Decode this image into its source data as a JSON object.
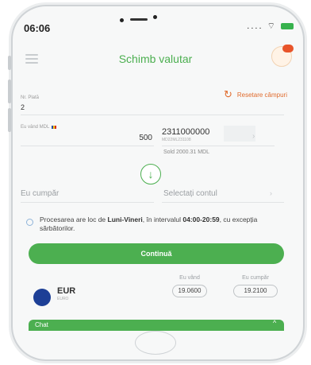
{
  "status": {
    "time": "06:06",
    "signal": "....",
    "wifi": "⌔"
  },
  "header": {
    "title": "Schimb valutar",
    "menu_icon": "hamburger-icon",
    "profile_icon": "avatar-icon"
  },
  "reset": {
    "label": "Resetare câmpuri",
    "icon": "refresh-icon"
  },
  "form": {
    "nr_label": "Nr. Plată",
    "nr_value": "2",
    "sell_label": "Eu vând MDL",
    "sell_amount": "500",
    "account_number": "2311000000",
    "account_masked": "MD22ML231108",
    "balance": "Sold 2000.31 MDL",
    "buy_placeholder": "Eu cumpăr",
    "currency_placeholder": "Selectați contul"
  },
  "info": {
    "part1": "Procesarea are loc de ",
    "days": "Luni-Vineri",
    "part2": ", în intervalul ",
    "hours": "04:00-20:59",
    "part3": ", cu excepția sărbătorilor."
  },
  "continue_label": "Continuă",
  "rates": {
    "sell_header": "Eu vând",
    "buy_header": "Eu cumpăr",
    "currency_code": "EUR",
    "currency_name": "EURO",
    "sell_rate": "19.0600",
    "buy_rate": "19.2100"
  },
  "chat": {
    "label": "Chat",
    "chevron": "^"
  },
  "colors": {
    "accent": "#4caf50",
    "reset": "#e06b2d",
    "eu_flag": "#1d3f96"
  }
}
